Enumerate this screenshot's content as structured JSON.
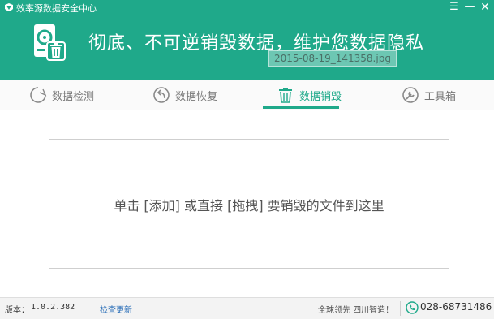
{
  "window": {
    "title": "效率源数据安全中心",
    "menu_glyph": "☰",
    "min_glyph": "—",
    "close_glyph": "✕"
  },
  "hero": {
    "slogan": "彻底、不可逆销毁数据，维护您数据隐私",
    "dragged_file": "2015-08-19_141358.jpg"
  },
  "tabs": [
    {
      "label": "数据检测",
      "icon": "refresh-circle-icon",
      "active": false
    },
    {
      "label": "数据恢复",
      "icon": "back-arrow-circle-icon",
      "active": false
    },
    {
      "label": "数据销毁",
      "icon": "trash-icon",
      "active": true
    },
    {
      "label": "工具箱",
      "icon": "wrench-icon",
      "active": false
    }
  ],
  "dropzone": {
    "hint": "单击 [添加] 或直接 [拖拽] 要销毁的文件到这里"
  },
  "status": {
    "version_label": "版本：",
    "version": "1.0.2.382",
    "update_link": "检查更新",
    "tagline": "全球领先  四川智造！",
    "phone": "028-68731486"
  },
  "colors": {
    "brand": "#1fa98a",
    "link": "#2b6fb8"
  }
}
